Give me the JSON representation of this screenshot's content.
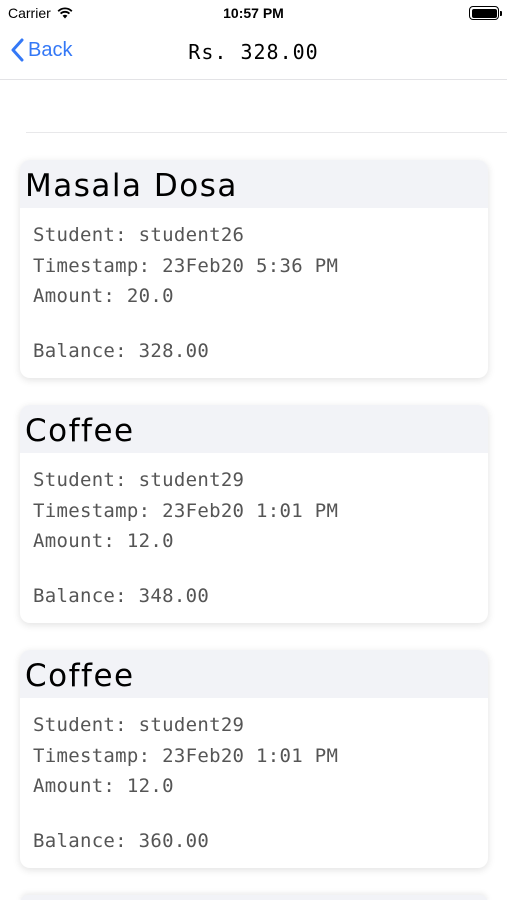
{
  "status_bar": {
    "carrier": "Carrier",
    "time": "10:57 PM"
  },
  "nav": {
    "back_label": "Back",
    "title": "Rs. 328.00"
  },
  "transactions": [
    {
      "title": "Masala Dosa",
      "student": "Student: student26",
      "timestamp": "Timestamp: 23Feb20 5:36 PM",
      "amount": "Amount: 20.0",
      "balance": "Balance: 328.00"
    },
    {
      "title": "Coffee",
      "student": "Student: student29",
      "timestamp": "Timestamp: 23Feb20 1:01 PM",
      "amount": "Amount: 12.0",
      "balance": "Balance: 348.00"
    },
    {
      "title": "Coffee",
      "student": "Student: student29",
      "timestamp": "Timestamp: 23Feb20 1:01 PM",
      "amount": "Amount: 12.0",
      "balance": "Balance: 360.00"
    }
  ],
  "colors": {
    "accent": "#3478f6",
    "card_header": "#f2f3f7",
    "body_text": "#555555"
  }
}
